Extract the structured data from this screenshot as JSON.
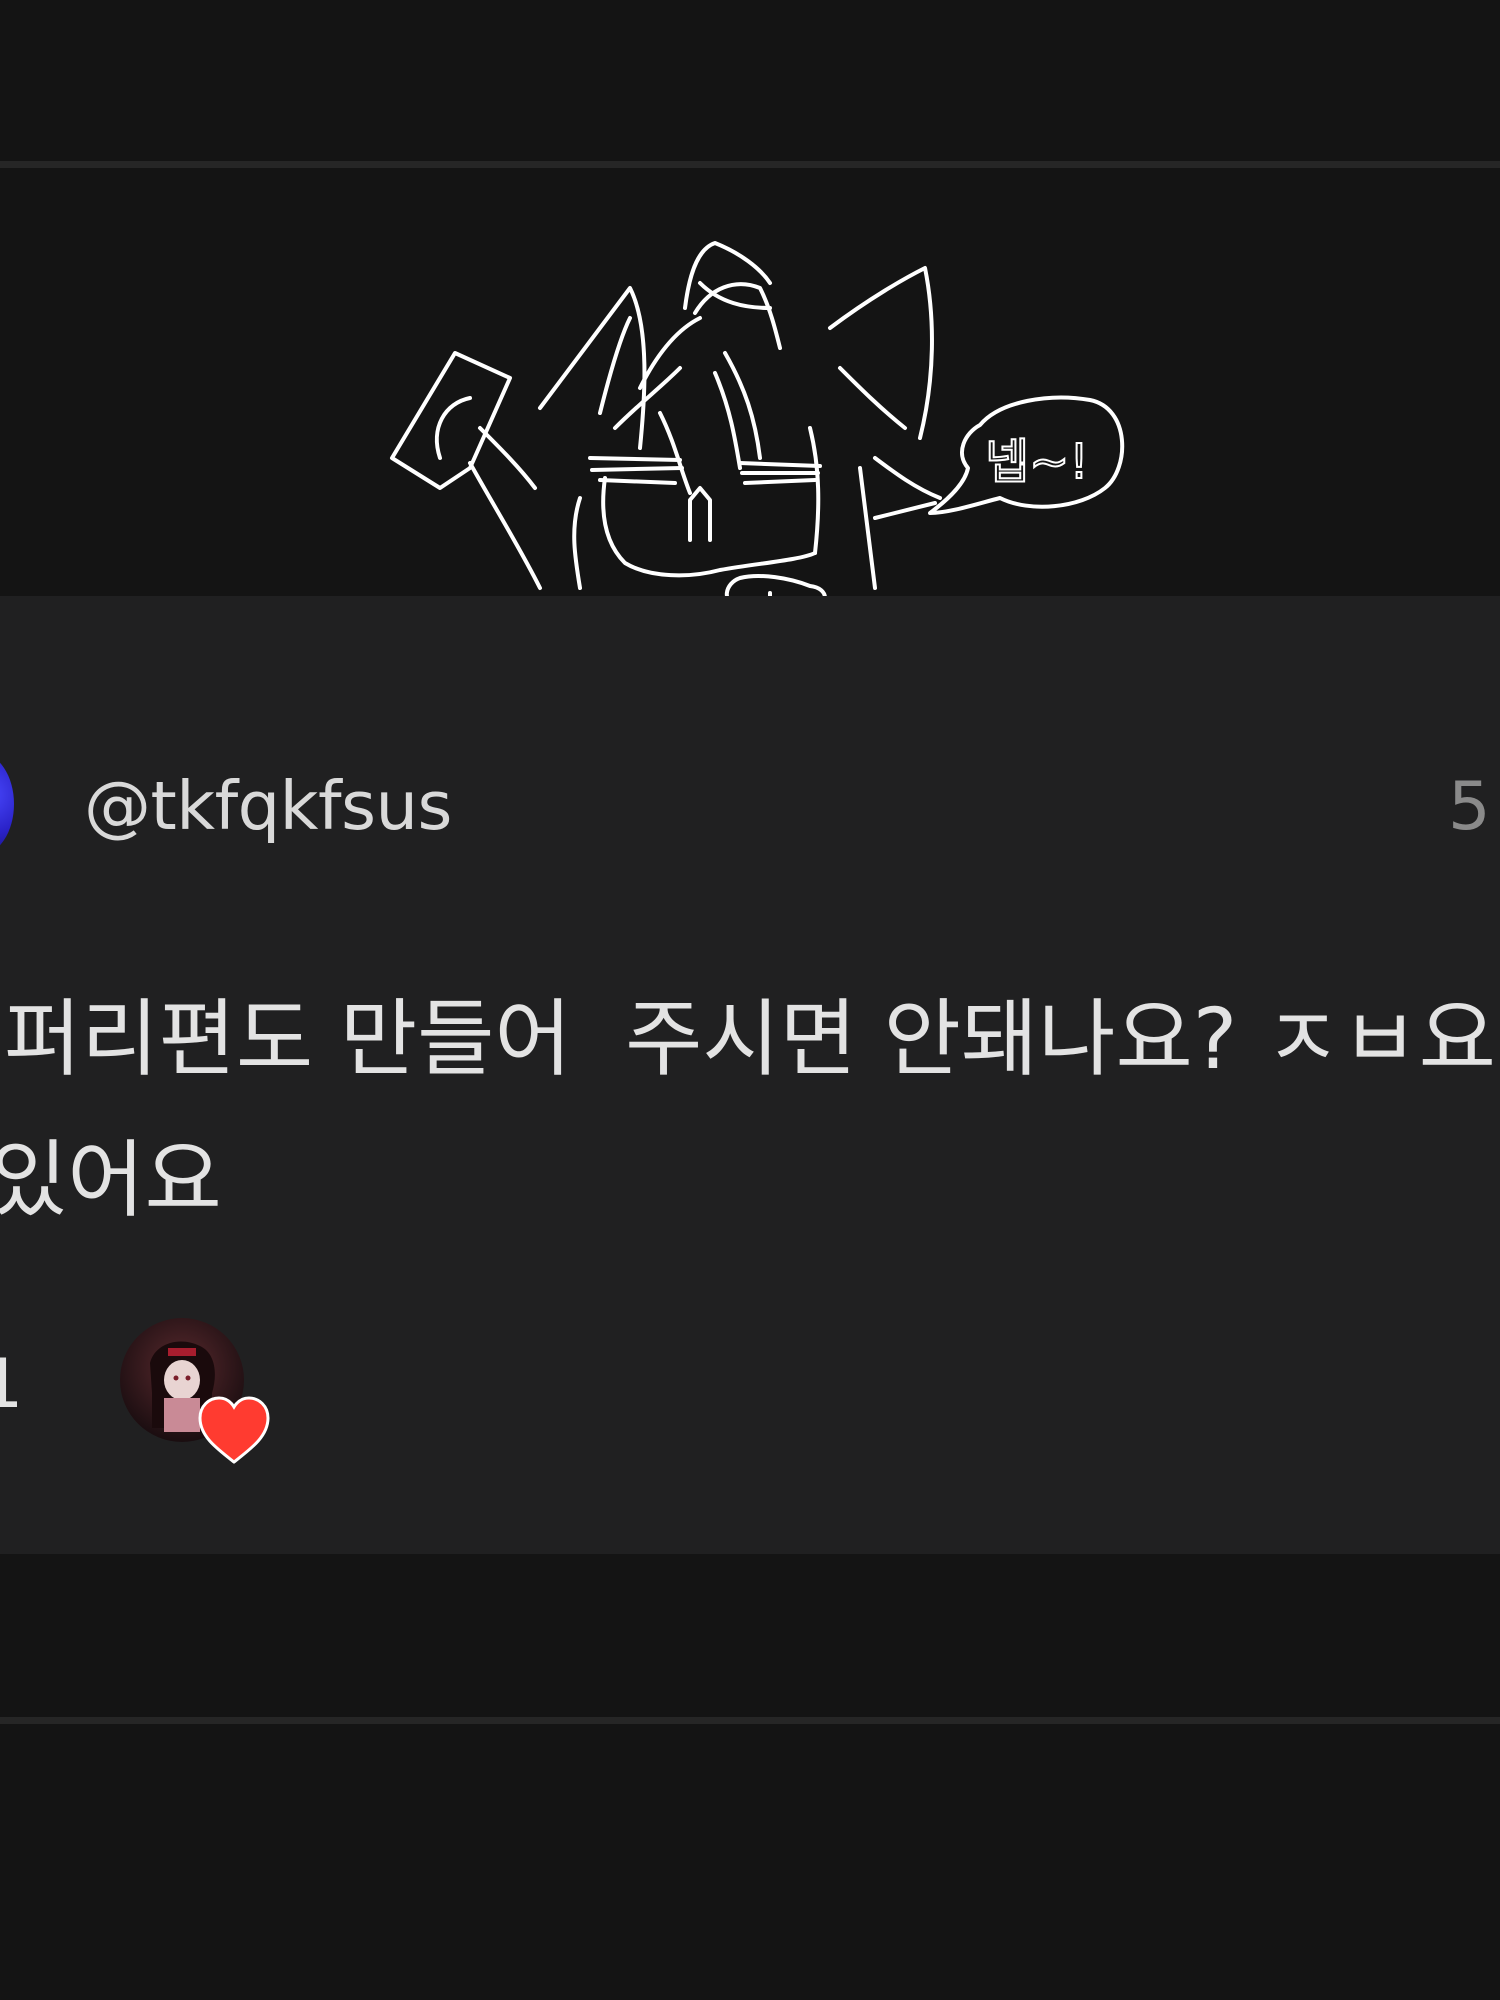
{
  "comment": {
    "username": "@tkfqkfsus",
    "time": "5",
    "text_lines": [
      "퍼리편도 만들어  주시면 안돼나요? ㅈㅂ요",
      "있어요"
    ],
    "like_count": "1"
  },
  "drawing": {
    "speech_bubble_text": "넵~!"
  },
  "icons": {
    "avatar": "user-avatar-icon",
    "creator_heart": "heart-icon"
  },
  "colors": {
    "background": "#141414",
    "card": "#202021",
    "heart": "#ff3b30",
    "avatar": "#2a22c8"
  }
}
